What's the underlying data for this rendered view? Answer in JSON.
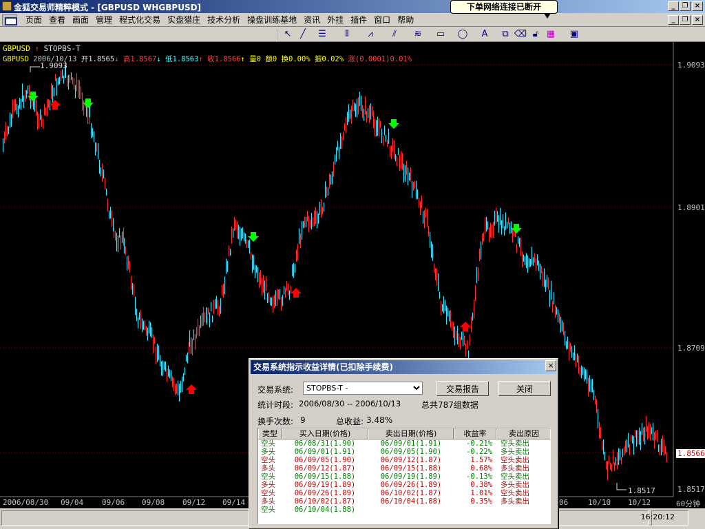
{
  "window": {
    "title": "金狐交易师精粹模式 - [GBPUSD WHGBPUSD]",
    "notification": "下单网络连接已断开"
  },
  "menu": [
    "页面",
    "查看",
    "画面",
    "管理",
    "程式化交易",
    "实盘猎庄",
    "技术分析",
    "操盘训练基地",
    "资讯",
    "外挂",
    "插件",
    "窗口",
    "帮助"
  ],
  "chart": {
    "header1": {
      "symbol": "GBPUSD",
      "system": "STOPBS-T"
    },
    "header2": {
      "symbol": "GBPUSD",
      "date": "2006/10/13",
      "open": "开1.8565",
      "high": "高1.8567",
      "low": "低1.8563",
      "close": "收1.8566",
      "vol": "量0",
      "amount": "额0",
      "turnover": "换0.00%",
      "amplitude": "振0.02%",
      "change": "涨(0.0001)0.01%"
    },
    "y_labels": [
      "1.9093",
      "1.8901",
      "1.8709",
      "1.8566",
      "1.8517"
    ],
    "x_labels": [
      "2006/08/30",
      "09/04",
      "09/06",
      "09/08",
      "09/12",
      "09/14",
      "06",
      "10/10",
      "10/12",
      "60分钟"
    ],
    "annotations": {
      "max": "1.9093",
      "min": "1.8517"
    },
    "colors": {
      "up": "#ff3030",
      "down": "#40e0ff",
      "buy": "#ff0000",
      "sell": "#00ff00",
      "info": "#ffff00",
      "grid": "#800000"
    }
  },
  "dialog": {
    "title": "交易系统指示收益详情(已扣除手续费)",
    "system_label": "交易系统:",
    "system_value": "STOPBS-T -",
    "report_button": "交易报告",
    "close_button": "关闭",
    "period_label": "统计时段:",
    "period_value": "2006/08/30 -- 2006/10/13",
    "count_value": "总共787组数据",
    "trades_label": "换手次数:",
    "trades_value": "9",
    "profit_label": "总收益:",
    "profit_value": "3.48%",
    "columns": [
      "类型",
      "买入日期(价格)",
      "卖出日期(价格)",
      "收益率",
      "卖出原因"
    ],
    "rows": [
      {
        "type": "空头",
        "buy": "06/08/31(1.90)",
        "sell": "06/09/01(1.91)",
        "ret": "-0.21%",
        "reason": "空头卖出",
        "color": "#008000"
      },
      {
        "type": "多头",
        "buy": "06/09/01(1.91)",
        "sell": "06/09/05(1.90)",
        "ret": "-0.22%",
        "reason": "多头卖出",
        "color": "#008000"
      },
      {
        "type": "空头",
        "buy": "06/09/05(1.90)",
        "sell": "06/09/12(1.87)",
        "ret": "1.57%",
        "reason": "空头卖出",
        "color": "#c00000"
      },
      {
        "type": "多头",
        "buy": "06/09/12(1.87)",
        "sell": "06/09/15(1.88)",
        "ret": "0.68%",
        "reason": "多头卖出",
        "color": "#c00000"
      },
      {
        "type": "空头",
        "buy": "06/09/15(1.88)",
        "sell": "06/09/19(1.89)",
        "ret": "-0.13%",
        "reason": "空头卖出",
        "color": "#008000"
      },
      {
        "type": "多头",
        "buy": "06/09/19(1.89)",
        "sell": "06/09/26(1.89)",
        "ret": "0.38%",
        "reason": "多头卖出",
        "color": "#c00000"
      },
      {
        "type": "空头",
        "buy": "06/09/26(1.89)",
        "sell": "06/10/02(1.87)",
        "ret": "1.01%",
        "reason": "空头卖出",
        "color": "#c00000"
      },
      {
        "type": "多头",
        "buy": "06/10/02(1.87)",
        "sell": "06/10/04(1.88)",
        "ret": "0.35%",
        "reason": "多头卖出",
        "color": "#c00000"
      },
      {
        "type": "空头",
        "buy": "06/10/04(1.88)",
        "sell": "",
        "ret": "",
        "reason": "",
        "color": "#008000"
      }
    ]
  },
  "status": {
    "time": "16:20:12"
  }
}
